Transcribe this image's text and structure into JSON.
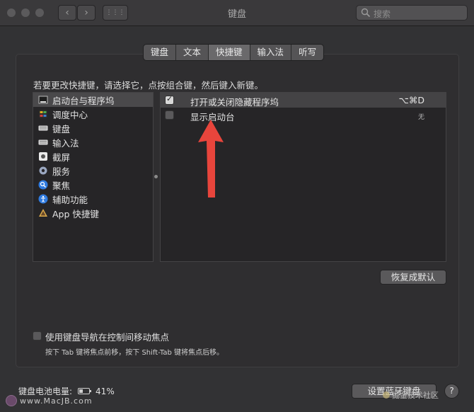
{
  "window": {
    "title": "键盘"
  },
  "search": {
    "placeholder": "搜索"
  },
  "nav": {
    "back": "‹",
    "forward": "›",
    "grid": "⋮⋮⋮"
  },
  "tabs": [
    {
      "label": "键盘"
    },
    {
      "label": "文本"
    },
    {
      "label": "快捷键"
    },
    {
      "label": "输入法"
    },
    {
      "label": "听写"
    }
  ],
  "instruction": "若要更改快捷键，请选择它，点按组合键，然后键入新键。",
  "categories": [
    {
      "label": "启动台与程序坞",
      "icon": "launchpad-dock-icon"
    },
    {
      "label": "调度中心",
      "icon": "mission-control-icon"
    },
    {
      "label": "键盘",
      "icon": "keyboard-icon"
    },
    {
      "label": "输入法",
      "icon": "input-source-icon"
    },
    {
      "label": "截屏",
      "icon": "screenshot-icon"
    },
    {
      "label": "服务",
      "icon": "gear-icon"
    },
    {
      "label": "聚焦",
      "icon": "spotlight-icon"
    },
    {
      "label": "辅助功能",
      "icon": "accessibility-icon"
    },
    {
      "label": "App 快捷键",
      "icon": "app-shortcuts-icon"
    }
  ],
  "shortcuts": [
    {
      "label": "打开或关闭隐藏程序坞",
      "key": "⌥⌘D",
      "checked": true
    },
    {
      "label": "显示启动台",
      "key": "无",
      "checked": false
    }
  ],
  "buttons": {
    "restore_defaults": "恢复成默认",
    "setup_bluetooth": "设置蓝牙键盘",
    "help": "?"
  },
  "keyboard_nav": {
    "label": "使用键盘导航在控制间移动焦点",
    "hint": "按下 Tab 键将焦点前移，按下 Shift-Tab 键将焦点后移。"
  },
  "battery": {
    "label": "键盘电池电量:",
    "percent_text": "41%",
    "level": 0.41
  },
  "watermarks": {
    "left": "www.MacJB.com",
    "right": "掘金技术社区"
  },
  "colors": {
    "arrow": "#e8453c"
  }
}
